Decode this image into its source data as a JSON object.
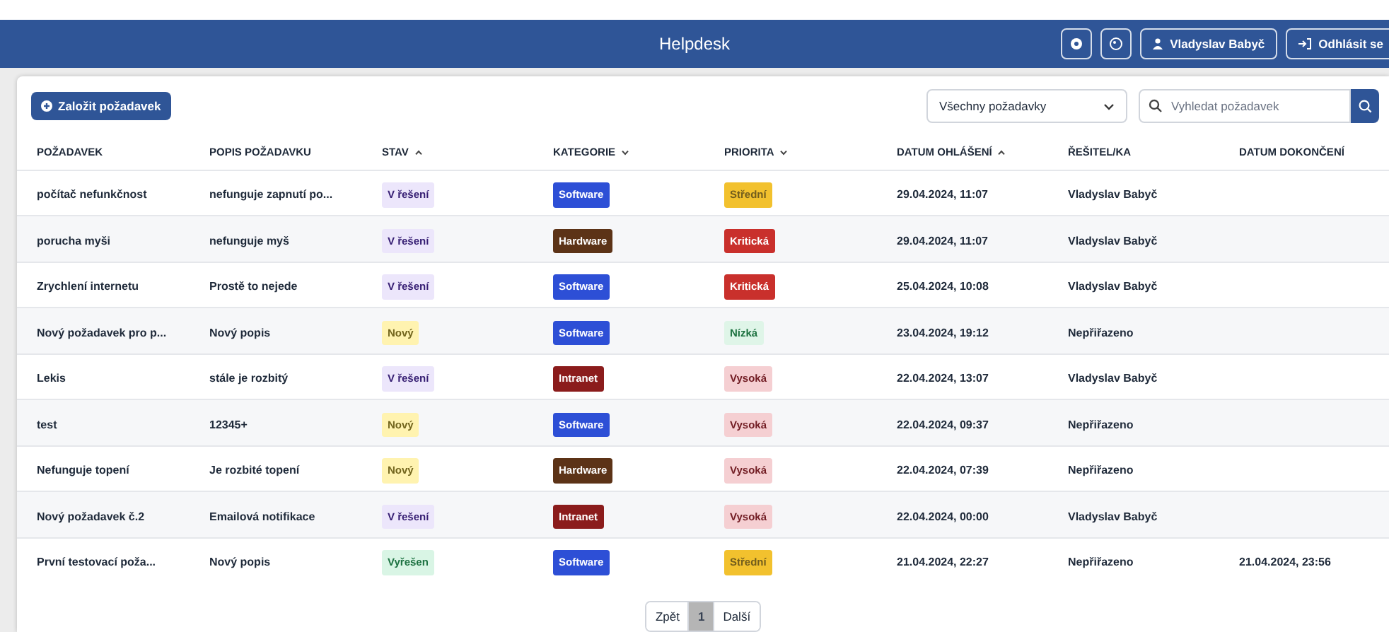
{
  "header": {
    "title": "Helpdesk",
    "user": "Vladyslav Babyč",
    "logout": "Odhlásit se"
  },
  "toolbar": {
    "create": "Založit požadavek",
    "filter": "Všechny požadavky",
    "search_placeholder": "Vyhledat požadavek"
  },
  "table": {
    "columns": [
      {
        "label": "POŽADAVEK",
        "sort_up": false,
        "sort_down": false
      },
      {
        "label": "POPIS POŽADAVKU",
        "sort_up": false,
        "sort_down": false
      },
      {
        "label": "STAV",
        "sort_up": true,
        "sort_down": false
      },
      {
        "label": "KATEGORIE",
        "sort_up": false,
        "sort_down": true
      },
      {
        "label": "PRIORITA",
        "sort_up": false,
        "sort_down": true
      },
      {
        "label": "DATUM OHLÁŠENÍ",
        "sort_up": true,
        "sort_down": false
      },
      {
        "label": "ŘEŠITEL/KA",
        "sort_up": false,
        "sort_down": false
      },
      {
        "label": "DATUM DOKONČENÍ",
        "sort_up": false,
        "sort_down": false
      }
    ],
    "rows": [
      {
        "name": "počítač nefunkčnost",
        "description": "nefunguje zapnutí po...",
        "status": {
          "text": "V řešení",
          "color": "#ece6fb"
        },
        "category": {
          "text": "Software",
          "color": "#2d4fd6"
        },
        "priority": {
          "text": "Střední",
          "color": "#f2c12e"
        },
        "reported": "29.04.2024, 11:07",
        "assignee": "Vladyslav Babyč"
      },
      {
        "name": "porucha myši",
        "description": "nefunguje myš",
        "status": {
          "text": "V řešení",
          "color": "#ece6fb"
        },
        "category": {
          "text": "Hardware",
          "color": "#5c3317"
        },
        "priority": {
          "text": "Kritická",
          "color": "#c9302c"
        },
        "reported": "29.04.2024, 11:07",
        "assignee": "Vladyslav Babyč"
      },
      {
        "name": "Zrychlení internetu",
        "description": "Prostě to nejede",
        "status": {
          "text": "V řešení",
          "color": "#ece6fb"
        },
        "category": {
          "text": "Software",
          "color": "#2d4fd6"
        },
        "priority": {
          "text": "Kritická",
          "color": "#c9302c"
        },
        "reported": "25.04.2024, 10:08",
        "assignee": "Vladyslav Babyč"
      },
      {
        "name": "Nový požadavek pro p...",
        "description": "Nový popis",
        "status": {
          "text": "Nový",
          "color": "#fff3b0"
        },
        "category": {
          "text": "Software",
          "color": "#2d4fd6"
        },
        "priority": {
          "text": "Nízká",
          "color": "#dff5e8"
        },
        "reported": "23.04.2024, 19:12",
        "assignee": "Nepřiřazeno"
      },
      {
        "name": "Lekis",
        "description": "stále je rozbitý",
        "status": {
          "text": "V řešení",
          "color": "#ece6fb"
        },
        "category": {
          "text": "Intranet",
          "color": "#8b1c1c"
        },
        "priority": {
          "text": "Vysoká",
          "color": "#f5cfd2"
        },
        "reported": "22.04.2024, 13:07",
        "assignee": "Vladyslav Babyč"
      },
      {
        "name": "test",
        "description": "12345+",
        "status": {
          "text": "Nový",
          "color": "#fff3b0"
        },
        "category": {
          "text": "Software",
          "color": "#2d4fd6"
        },
        "priority": {
          "text": "Vysoká",
          "color": "#f5cfd2"
        },
        "reported": "22.04.2024, 09:37",
        "assignee": "Nepřiřazeno"
      },
      {
        "name": "Nefunguje topení",
        "description": "Je rozbité topení",
        "status": {
          "text": "Nový",
          "color": "#fff3b0"
        },
        "category": {
          "text": "Hardware",
          "color": "#5c3317"
        },
        "priority": {
          "text": "Vysoká",
          "color": "#f5cfd2"
        },
        "reported": "22.04.2024, 07:39",
        "assignee": "Nepřiřazeno"
      },
      {
        "name": "Nový požadavek č.2",
        "description": "Emailová notifikace",
        "status": {
          "text": "V řešení",
          "color": "#ece6fb"
        },
        "category": {
          "text": "Intranet",
          "color": "#8b1c1c"
        },
        "priority": {
          "text": "Vysoká",
          "color": "#f5cfd2"
        },
        "reported": "22.04.2024, 00:00",
        "assignee": "Vladyslav Babyč"
      },
      {
        "name": "První testovací poža...",
        "description": "Nový popis",
        "status": {
          "text": "Vyřešen",
          "color": "#d9f5e5"
        },
        "category": {
          "text": "Software",
          "color": "#2d4fd6"
        },
        "priority": {
          "text": "Střední",
          "color": "#f2c12e"
        },
        "reported": "21.04.2024, 22:27",
        "assignee": "Nepřiřazeno",
        "completed": "21.04.2024, 23:56"
      }
    ]
  },
  "pagination": [
    {
      "label": "Zpět",
      "selected": false
    },
    {
      "label": "1",
      "selected": true
    },
    {
      "label": "Další",
      "selected": false
    }
  ]
}
